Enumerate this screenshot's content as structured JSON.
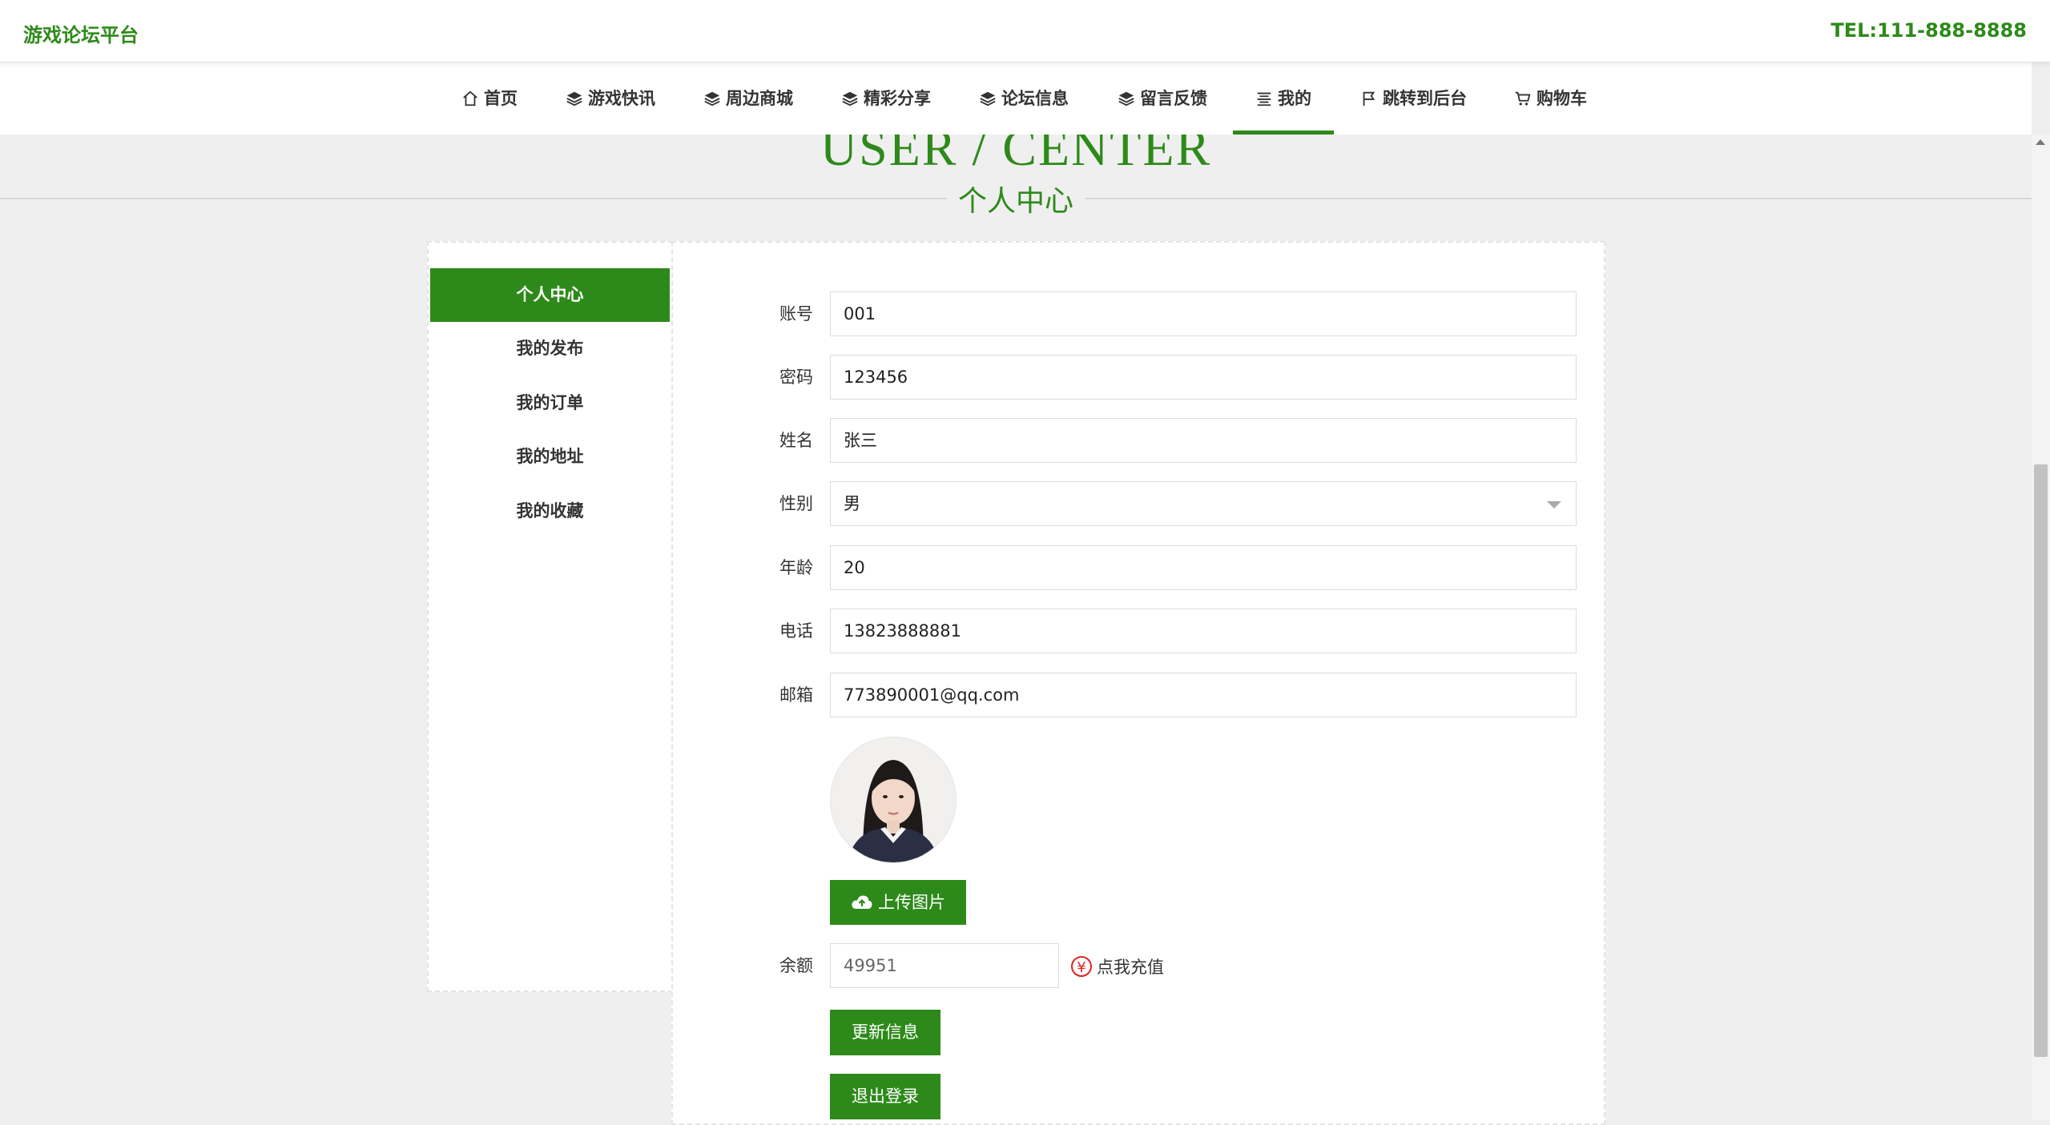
{
  "header": {
    "logo": "游戏论坛平台",
    "tel": "TEL:111-888-8888"
  },
  "nav": [
    {
      "label": "首页",
      "icon": "home-icon"
    },
    {
      "label": "游戏快讯",
      "icon": "layers-icon"
    },
    {
      "label": "周边商城",
      "icon": "layers-icon"
    },
    {
      "label": "精彩分享",
      "icon": "layers-icon"
    },
    {
      "label": "论坛信息",
      "icon": "layers-icon"
    },
    {
      "label": "留言反馈",
      "icon": "layers-icon"
    },
    {
      "label": "我的",
      "icon": "menu-icon",
      "active": true
    },
    {
      "label": "跳转到后台",
      "icon": "flag-icon"
    },
    {
      "label": "购物车",
      "icon": "cart-icon"
    }
  ],
  "page": {
    "title_en": "USER / CENTER",
    "title_cn": "个人中心"
  },
  "sidebar": [
    {
      "label": "个人中心",
      "active": true
    },
    {
      "label": "我的发布"
    },
    {
      "label": "我的订单"
    },
    {
      "label": "我的地址"
    },
    {
      "label": "我的收藏"
    }
  ],
  "form": {
    "account": {
      "label": "账号",
      "value": "001"
    },
    "password": {
      "label": "密码",
      "value": "123456"
    },
    "name": {
      "label": "姓名",
      "value": "张三"
    },
    "gender": {
      "label": "性别",
      "value": "男"
    },
    "age": {
      "label": "年龄",
      "value": "20"
    },
    "phone": {
      "label": "电话",
      "value": "13823888881"
    },
    "email": {
      "label": "邮箱",
      "value": "773890001@qq.com"
    },
    "upload_label": "上传图片",
    "balance": {
      "label": "余额",
      "value": "49951"
    },
    "recharge_label": "点我充值",
    "update_label": "更新信息",
    "logout_label": "退出登录"
  },
  "colors": {
    "primary": "#2d8a1a",
    "background": "#efefef"
  }
}
